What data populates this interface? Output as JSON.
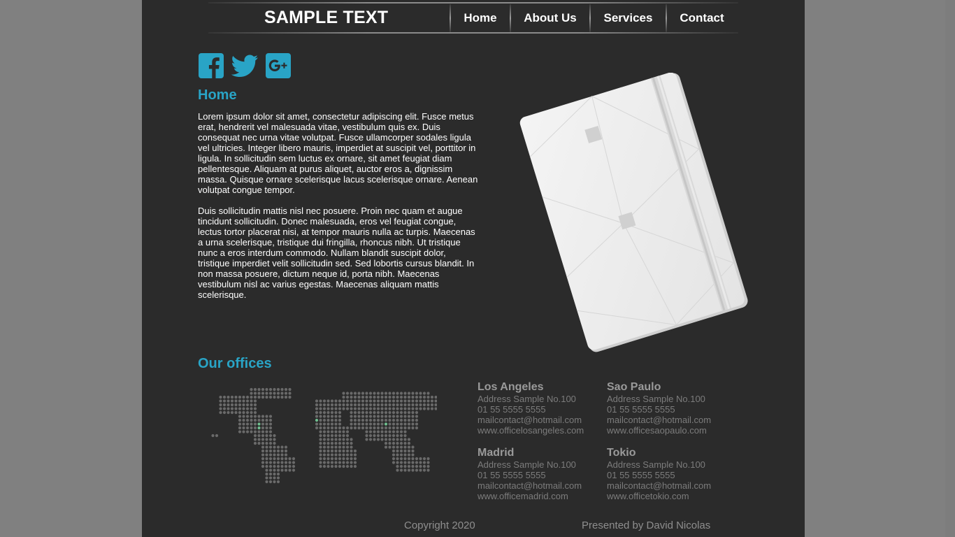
{
  "header": {
    "site_title": "SAMPLE TEXT",
    "nav": [
      "Home",
      "About Us",
      "Services",
      "Contact"
    ]
  },
  "social": {
    "icons": [
      "facebook-icon",
      "twitter-icon",
      "google-plus-icon"
    ],
    "color": "#29a4c6"
  },
  "home": {
    "title": "Home",
    "paragraph1": "Lorem ipsum dolor sit amet, consectetur adipiscing elit. Fusce metus erat, hendrerit vel malesuada vitae, vestibulum quis ex. Duis consequat nec urna vitae volutpat. Fusce ullamcorper sodales ligula vel ultricies. Integer libero mauris, imperdiet at suscipit vel, porttitor in ligula. In sollicitudin sem luctus ex ornare, sit amet feugiat diam pellentesque. Aliquam at purus aliquet, auctor eros a, dignissim massa. Quisque ornare scelerisque lacus scelerisque ornare. Aenean volutpat congue tempor.",
    "paragraph2": "Duis sollicitudin mattis nisl nec posuere. Proin nec quam et augue tincidunt sollicitudin. Donec malesuada, eros vel feugiat congue, lectus tortor placerat nisi, at tempor mauris nulla ac turpis. Maecenas a urna scelerisque, tristique dui fringilla, rhoncus nibh. Ut tristique nunc a eros interdum commodo. Nullam blandit suscipit dolor, tristique imperdiet velit sollicitudin sed. Sed lobortis cursus blandit. In non massa posuere, dictum neque id, porta nibh. Maecenas vestibulum nisl ac varius egestas. Maecenas aliquam mattis scelerisque."
  },
  "offices": {
    "title": "Our offices",
    "list": [
      {
        "name": "Los Angeles",
        "address": "Address Sample No.100",
        "phone": "01 55 5555 5555",
        "email": "mailcontact@hotmail.com",
        "web": "www.officelosangeles.com"
      },
      {
        "name": "Sao Paulo",
        "address": "Address Sample No.100",
        "phone": "01 55 5555 5555",
        "email": "mailcontact@hotmail.com",
        "web": "www.officesaopaulo.com"
      },
      {
        "name": "Madrid",
        "address": "Address Sample No.100",
        "phone": "01 55 5555 5555",
        "email": "mailcontact@hotmail.com",
        "web": "www.officemadrid.com"
      },
      {
        "name": "Tokio",
        "address": "Address Sample No.100",
        "phone": "01 55 5555 5555",
        "email": "mailcontact@hotmail.com",
        "web": "www.officetokio.com"
      }
    ]
  },
  "footer": {
    "copyright": "Copyright 2020",
    "credit": "Presented by David Nicolas"
  },
  "colors": {
    "accent": "#29a4c6",
    "page_bg": "#2b2b2b",
    "outer_bg": "#808080",
    "map_highlight": "#6fbf8f"
  }
}
